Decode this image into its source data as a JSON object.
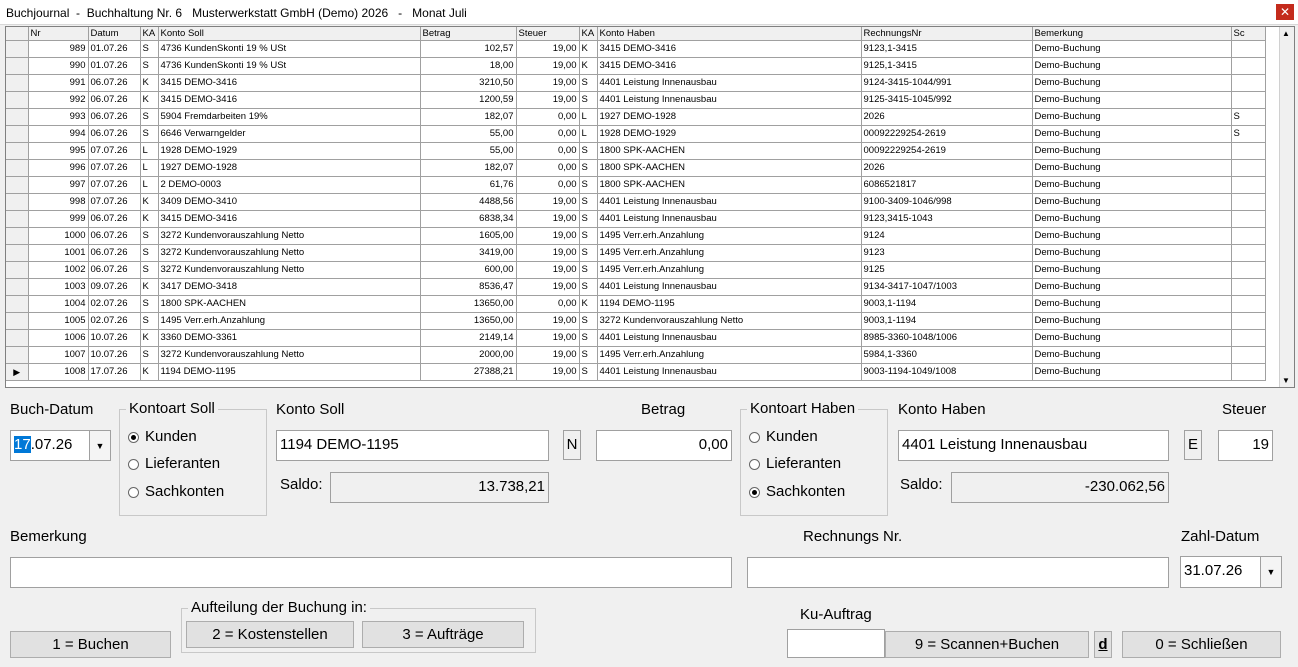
{
  "window": {
    "title": "Buchjournal  -  Buchhaltung Nr. 6   Musterwerkstatt GmbH (Demo) 2026   -   Monat Juli"
  },
  "grid": {
    "headers": [
      "",
      "Nr",
      "Datum",
      "KA",
      "Konto Soll",
      "Betrag",
      "Steuer",
      "KA",
      "Konto Haben",
      "RechnungsNr",
      "Bemerkung",
      "Sc"
    ],
    "rows": [
      [
        "",
        "989",
        "01.07.26",
        "S",
        "4736  KundenSkonti 19 % USt",
        "102,57",
        "19,00",
        "K",
        "3415  DEMO-3416",
        "9123,1-3415",
        "Demo-Buchung",
        ""
      ],
      [
        "",
        "990",
        "01.07.26",
        "S",
        "4736  KundenSkonti 19 % USt",
        "18,00",
        "19,00",
        "K",
        "3415  DEMO-3416",
        "9125,1-3415",
        "Demo-Buchung",
        ""
      ],
      [
        "",
        "991",
        "06.07.26",
        "K",
        "3415  DEMO-3416",
        "3210,50",
        "19,00",
        "S",
        "4401  Leistung Innenausbau",
        "9124-3415-1044/991",
        "Demo-Buchung",
        ""
      ],
      [
        "",
        "992",
        "06.07.26",
        "K",
        "3415  DEMO-3416",
        "1200,59",
        "19,00",
        "S",
        "4401  Leistung Innenausbau",
        "9125-3415-1045/992",
        "Demo-Buchung",
        ""
      ],
      [
        "",
        "993",
        "06.07.26",
        "S",
        "5904  Fremdarbeiten 19%",
        "182,07",
        "0,00",
        "L",
        "1927  DEMO-1928",
        "2026",
        "Demo-Buchung",
        "S"
      ],
      [
        "",
        "994",
        "06.07.26",
        "S",
        "6646  Verwarngelder",
        "55,00",
        "0,00",
        "L",
        "1928  DEMO-1929",
        "00092229254-2619",
        "Demo-Buchung",
        "S"
      ],
      [
        "",
        "995",
        "07.07.26",
        "L",
        "1928  DEMO-1929",
        "55,00",
        "0,00",
        "S",
        "1800  SPK-AACHEN",
        "00092229254-2619",
        "Demo-Buchung",
        ""
      ],
      [
        "",
        "996",
        "07.07.26",
        "L",
        "1927  DEMO-1928",
        "182,07",
        "0,00",
        "S",
        "1800  SPK-AACHEN",
        "2026",
        "Demo-Buchung",
        ""
      ],
      [
        "",
        "997",
        "07.07.26",
        "L",
        "2  DEMO-0003",
        "61,76",
        "0,00",
        "S",
        "1800  SPK-AACHEN",
        "6086521817",
        "Demo-Buchung",
        ""
      ],
      [
        "",
        "998",
        "07.07.26",
        "K",
        "3409  DEMO-3410",
        "4488,56",
        "19,00",
        "S",
        "4401  Leistung Innenausbau",
        "9100-3409-1046/998",
        "Demo-Buchung",
        ""
      ],
      [
        "",
        "999",
        "06.07.26",
        "K",
        "3415  DEMO-3416",
        "6838,34",
        "19,00",
        "S",
        "4401  Leistung Innenausbau",
        "9123,3415-1043",
        "Demo-Buchung",
        ""
      ],
      [
        "",
        "1000",
        "06.07.26",
        "S",
        "3272  Kundenvorauszahlung Netto",
        "1605,00",
        "19,00",
        "S",
        "1495  Verr.erh.Anzahlung",
        "9124",
        "Demo-Buchung",
        ""
      ],
      [
        "",
        "1001",
        "06.07.26",
        "S",
        "3272  Kundenvorauszahlung Netto",
        "3419,00",
        "19,00",
        "S",
        "1495  Verr.erh.Anzahlung",
        "9123",
        "Demo-Buchung",
        ""
      ],
      [
        "",
        "1002",
        "06.07.26",
        "S",
        "3272  Kundenvorauszahlung Netto",
        "600,00",
        "19,00",
        "S",
        "1495  Verr.erh.Anzahlung",
        "9125",
        "Demo-Buchung",
        ""
      ],
      [
        "",
        "1003",
        "09.07.26",
        "K",
        "3417  DEMO-3418",
        "8536,47",
        "19,00",
        "S",
        "4401  Leistung Innenausbau",
        "9134-3417-1047/1003",
        "Demo-Buchung",
        ""
      ],
      [
        "",
        "1004",
        "02.07.26",
        "S",
        "1800  SPK-AACHEN",
        "13650,00",
        "0,00",
        "K",
        "1194  DEMO-1195",
        "9003,1-1194",
        "Demo-Buchung",
        ""
      ],
      [
        "",
        "1005",
        "02.07.26",
        "S",
        "1495  Verr.erh.Anzahlung",
        "13650,00",
        "19,00",
        "S",
        "3272  Kundenvorauszahlung Netto",
        "9003,1-1194",
        "Demo-Buchung",
        ""
      ],
      [
        "",
        "1006",
        "10.07.26",
        "K",
        "3360  DEMO-3361",
        "2149,14",
        "19,00",
        "S",
        "4401  Leistung Innenausbau",
        "8985-3360-1048/1006",
        "Demo-Buchung",
        ""
      ],
      [
        "",
        "1007",
        "10.07.26",
        "S",
        "3272  Kundenvorauszahlung Netto",
        "2000,00",
        "19,00",
        "S",
        "1495  Verr.erh.Anzahlung",
        "5984,1-3360",
        "Demo-Buchung",
        ""
      ],
      [
        "▶",
        "1008",
        "17.07.26",
        "K",
        "1194  DEMO-1195",
        "27388,21",
        "19,00",
        "S",
        "4401  Leistung Innenausbau",
        "9003-1194-1049/1008",
        "Demo-Buchung",
        ""
      ]
    ]
  },
  "form": {
    "buch_datum_label": "Buch-Datum",
    "buch_datum_sel": "17",
    "buch_datum_rest": ".07.26",
    "kontoart_soll_label": "Kontoart Soll",
    "kontoart_haben_label": "Kontoart Haben",
    "radio_kunden": "Kunden",
    "radio_lieferanten": "Lieferanten",
    "radio_sachkonten": "Sachkonten",
    "konto_soll_label": "Konto Soll",
    "konto_soll_value": "1194  DEMO-1195",
    "soll_flag": "N",
    "betrag_label": "Betrag",
    "betrag_value": "0,00",
    "saldo_label": "Saldo:",
    "saldo_soll_value": "13.738,21",
    "konto_haben_label": "Konto Haben",
    "konto_haben_value": "4401  Leistung Innenausbau",
    "haben_flag": "E",
    "steuer_label": "Steuer",
    "steuer_value": "19",
    "saldo_haben_value": "-230.062,56",
    "bemerkung_label": "Bemerkung",
    "bemerkung_value": "",
    "rechnungs_label": "Rechnungs Nr.",
    "rechnungs_value": "",
    "zahl_datum_label": "Zahl-Datum",
    "zahl_datum_value": "31.07.26",
    "aufteilung_label": "Aufteilung der Buchung in:",
    "ku_auftrag_label": "Ku-Auftrag",
    "ku_auftrag_value": ""
  },
  "buttons": {
    "buchen": "1 = Buchen",
    "kostenstellen": "2 = Kostenstellen",
    "auftraege": "3 = Aufträge",
    "scannen": "9 = Scannen+Buchen",
    "d": "d",
    "schliessen": "0 = Schließen"
  }
}
